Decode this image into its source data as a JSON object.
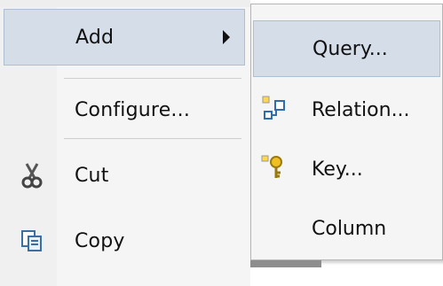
{
  "context_menu": {
    "items": [
      {
        "label": "Add",
        "has_submenu": true,
        "highlighted": true,
        "icon": ""
      },
      {
        "label": "Configure...",
        "has_submenu": false,
        "highlighted": false,
        "icon": ""
      },
      {
        "label": "Cut",
        "has_submenu": false,
        "highlighted": false,
        "icon": "scissors-icon"
      },
      {
        "label": "Copy",
        "has_submenu": false,
        "highlighted": false,
        "icon": "copy-icon"
      }
    ]
  },
  "submenu": {
    "items": [
      {
        "label": "Query...",
        "highlighted": true,
        "icon": ""
      },
      {
        "label": "Relation...",
        "highlighted": false,
        "icon": "relation-icon"
      },
      {
        "label": "Key...",
        "highlighted": false,
        "icon": "key-icon"
      },
      {
        "label": "Column",
        "highlighted": false,
        "icon": ""
      }
    ]
  },
  "colors": {
    "highlight": "#d4dde8",
    "highlight_border": "#aebfd4",
    "menu_bg": "#f5f5f5"
  }
}
